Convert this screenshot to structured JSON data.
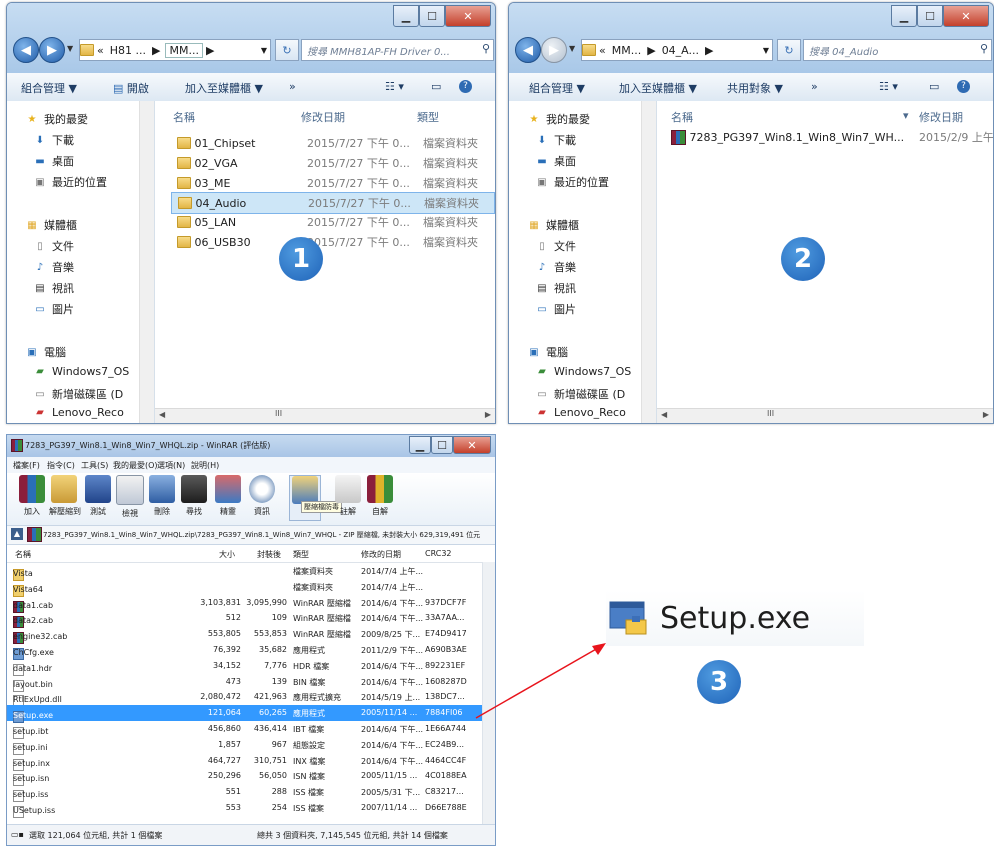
{
  "window1": {
    "nav_back": "◀",
    "nav_fwd": "▶",
    "addr_prefix": "«",
    "addr_seg1": "H81 ...",
    "addr_seg2": "MM...",
    "search_placeholder": "搜尋 MMH81AP-FH Driver 0...",
    "toolbar": {
      "organize": "組合管理 ▼",
      "open": "開啟",
      "include": "加入至媒體櫃 ▼",
      "more": "»"
    },
    "nav_pane": {
      "favorites": "我的最愛",
      "downloads": "下載",
      "desktop": "桌面",
      "recent": "最近的位置",
      "libraries": "媒體櫃",
      "documents": "文件",
      "music": "音樂",
      "videos": "視訊",
      "pictures": "圖片",
      "computer": "電腦",
      "drive_c": "Windows7_OS",
      "drive_d": "新增磁碟區 (D",
      "drive_e": "Lenovo_Reco"
    },
    "columns": {
      "name": "名稱",
      "date": "修改日期",
      "type": "類型"
    },
    "rows": [
      {
        "name": "01_Chipset",
        "date": "2015/7/27 下午 0...",
        "type": "檔案資料夾"
      },
      {
        "name": "02_VGA",
        "date": "2015/7/27 下午 0...",
        "type": "檔案資料夾"
      },
      {
        "name": "03_ME",
        "date": "2015/7/27 下午 0...",
        "type": "檔案資料夾"
      },
      {
        "name": "04_Audio",
        "date": "2015/7/27 下午 0...",
        "type": "檔案資料夾"
      },
      {
        "name": "05_LAN",
        "date": "2015/7/27 下午 0...",
        "type": "檔案資料夾"
      },
      {
        "name": "06_USB30",
        "date": "2015/7/27 下午 0...",
        "type": "檔案資料夾"
      }
    ],
    "step": "1"
  },
  "window2": {
    "addr_prefix": "«",
    "addr_seg1": "MM...",
    "addr_seg2": "04_A...",
    "search_placeholder": "搜尋 04_Audio",
    "toolbar": {
      "organize": "組合管理 ▼",
      "include": "加入至媒體櫃 ▼",
      "share": "共用對象 ▼",
      "more": "»"
    },
    "columns": {
      "name": "名稱",
      "date": "修改日期"
    },
    "rows": [
      {
        "name": "7283_PG397_Win8.1_Win8_Win7_WH...",
        "date": "2015/2/9 上午"
      }
    ],
    "step": "2"
  },
  "winrar": {
    "title": "7283_PG397_Win8.1_Win8_Win7_WHQL.zip - WinRAR (評估版)",
    "menu": [
      "檔案(F)",
      "指令(C)",
      "工具(S)",
      "我的最愛(O)",
      "選項(N)",
      "說明(H)"
    ],
    "tools": [
      "加入",
      "解壓縮到",
      "測試",
      "檢視",
      "刪除",
      "尋找",
      "精靈",
      "資訊",
      "",
      "註解",
      "自解"
    ],
    "tooltip": "壓縮檔防毒",
    "path": "7283_PG397_Win8.1_Win8_Win7_WHQL.zip\\7283_PG397_Win8.1_Win8_Win7_WHQL - ZIP 壓縮檔, 未封裝大小 629,319,491 位元",
    "columns": {
      "name": "名稱",
      "size": "大小",
      "packed": "封裝後",
      "type": "類型",
      "modified": "修改的日期",
      "crc": "CRC32"
    },
    "files": [
      {
        "name": "Vista",
        "size": "",
        "packed": "",
        "type": "檔案資料夾",
        "modified": "2014/7/4 上午...",
        "crc": "",
        "icon": "fold"
      },
      {
        "name": "Vista64",
        "size": "",
        "packed": "",
        "type": "檔案資料夾",
        "modified": "2014/7/4 上午...",
        "crc": "",
        "icon": "fold"
      },
      {
        "name": "data1.cab",
        "size": "3,103,831",
        "packed": "3,095,990",
        "type": "WinRAR 壓縮檔",
        "modified": "2014/6/4 下午...",
        "crc": "937DCF7F",
        "icon": "cab"
      },
      {
        "name": "data2.cab",
        "size": "512",
        "packed": "109",
        "type": "WinRAR 壓縮檔",
        "modified": "2014/6/4 下午...",
        "crc": "33A7AA...",
        "icon": "cab"
      },
      {
        "name": "engine32.cab",
        "size": "553,805",
        "packed": "553,853",
        "type": "WinRAR 壓縮檔",
        "modified": "2009/8/25 下...",
        "crc": "E74D9417",
        "icon": "cab"
      },
      {
        "name": "ChCfg.exe",
        "size": "76,392",
        "packed": "35,682",
        "type": "應用程式",
        "modified": "2011/2/9 下午...",
        "crc": "A690B3AE",
        "icon": "exe"
      },
      {
        "name": "data1.hdr",
        "size": "34,152",
        "packed": "7,776",
        "type": "HDR 檔案",
        "modified": "2014/6/4 下午...",
        "crc": "892231EF",
        "icon": "doc"
      },
      {
        "name": "layout.bin",
        "size": "473",
        "packed": "139",
        "type": "BIN 檔案",
        "modified": "2014/6/4 下午...",
        "crc": "1608287D",
        "icon": "doc"
      },
      {
        "name": "RtlExUpd.dll",
        "size": "2,080,472",
        "packed": "421,963",
        "type": "應用程式擴充",
        "modified": "2014/5/19 上...",
        "crc": "138DC7...",
        "icon": "doc"
      },
      {
        "name": "Setup.exe",
        "size": "121,064",
        "packed": "60,265",
        "type": "應用程式",
        "modified": "2005/11/14 ...",
        "crc": "7884FI06",
        "icon": "exe"
      },
      {
        "name": "setup.ibt",
        "size": "456,860",
        "packed": "436,414",
        "type": "IBT 檔案",
        "modified": "2014/6/4 下午...",
        "crc": "1E66A744",
        "icon": "doc"
      },
      {
        "name": "setup.ini",
        "size": "1,857",
        "packed": "967",
        "type": "組態設定",
        "modified": "2014/6/4 下午...",
        "crc": "EC24B9...",
        "icon": "doc"
      },
      {
        "name": "setup.inx",
        "size": "464,727",
        "packed": "310,751",
        "type": "INX 檔案",
        "modified": "2014/6/4 下午...",
        "crc": "4464CC4F",
        "icon": "doc"
      },
      {
        "name": "setup.isn",
        "size": "250,296",
        "packed": "56,050",
        "type": "ISN 檔案",
        "modified": "2005/11/15 ...",
        "crc": "4C0188EA",
        "icon": "doc"
      },
      {
        "name": "setup.iss",
        "size": "551",
        "packed": "288",
        "type": "ISS 檔案",
        "modified": "2005/5/31 下...",
        "crc": "C83217...",
        "icon": "doc"
      },
      {
        "name": "USetup.iss",
        "size": "553",
        "packed": "254",
        "type": "ISS 檔案",
        "modified": "2007/11/14 ...",
        "crc": "D66E788E",
        "icon": "doc"
      }
    ],
    "selected_index": 9,
    "status_left": "選取 121,064 位元組, 共計 1 個檔案",
    "status_right": "總共 3 個資料夾, 7,145,545 位元組, 共計 14 個檔案"
  },
  "callout": {
    "label": "Setup.exe",
    "step": "3",
    "arrow_color": "#e8141c"
  }
}
